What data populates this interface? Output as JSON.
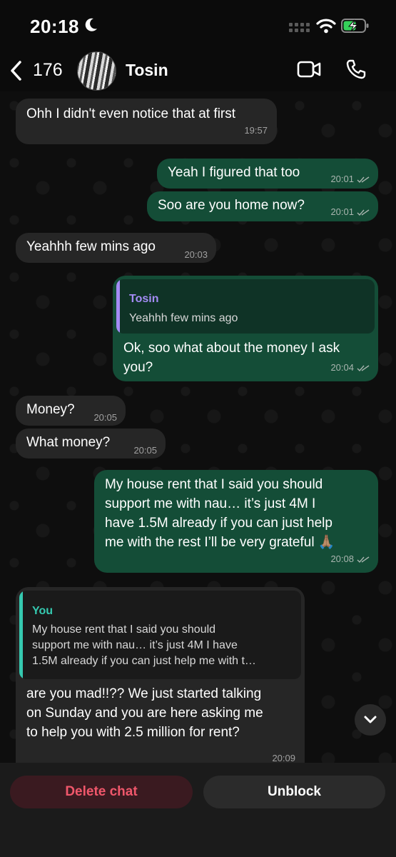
{
  "status_bar": {
    "time": "20:18"
  },
  "header": {
    "back_count": "176",
    "contact_name": "Tosin"
  },
  "messages": [
    {
      "text": "Ohh I didn't even notice that at first",
      "time": "19:57"
    },
    {
      "text": "Yeah I figured that too",
      "time": "20:01"
    },
    {
      "text": "Soo are you home now?",
      "time": "20:01"
    },
    {
      "text": "Yeahhh few mins ago",
      "time": "20:03"
    },
    {
      "quote_name": "Tosin",
      "quote_text": "Yeahhh few mins ago",
      "text_l1": "Ok, soo what about the money I ask",
      "text_l2": "you?",
      "time": "20:04"
    },
    {
      "text": "Money?",
      "time": "20:05"
    },
    {
      "text": "What money?",
      "time": "20:05"
    },
    {
      "text_l1": "My house rent that I said you should",
      "text_l2": "support me with nau… it’s just 4M I",
      "text_l3": "have 1.5M already if you can just help",
      "text_l4": "me with the rest I’ll be very grateful 🙏🏽",
      "time": "20:08"
    },
    {
      "quote_name": "You",
      "quote_l1": "My house rent that I said you should",
      "quote_l2": "support me with nau… it’s just 4M I have",
      "quote_l3": "1.5M already if you can just help me with t…",
      "text_l1": "are you mad!!?? We just started talking",
      "text_l2": "on Sunday and you are here asking me",
      "text_l3": "to help you with 2.5 million for rent?",
      "time": "20:09"
    }
  ],
  "actions": {
    "delete_label": "Delete chat",
    "unblock_label": "Unblock"
  },
  "colors": {
    "outgoing_bubble": "#144d37",
    "incoming_bubble": "#262626",
    "delete_text": "#f0576b",
    "quote_name_in": "#a48cf5",
    "quote_name_you": "#35c9b0"
  }
}
